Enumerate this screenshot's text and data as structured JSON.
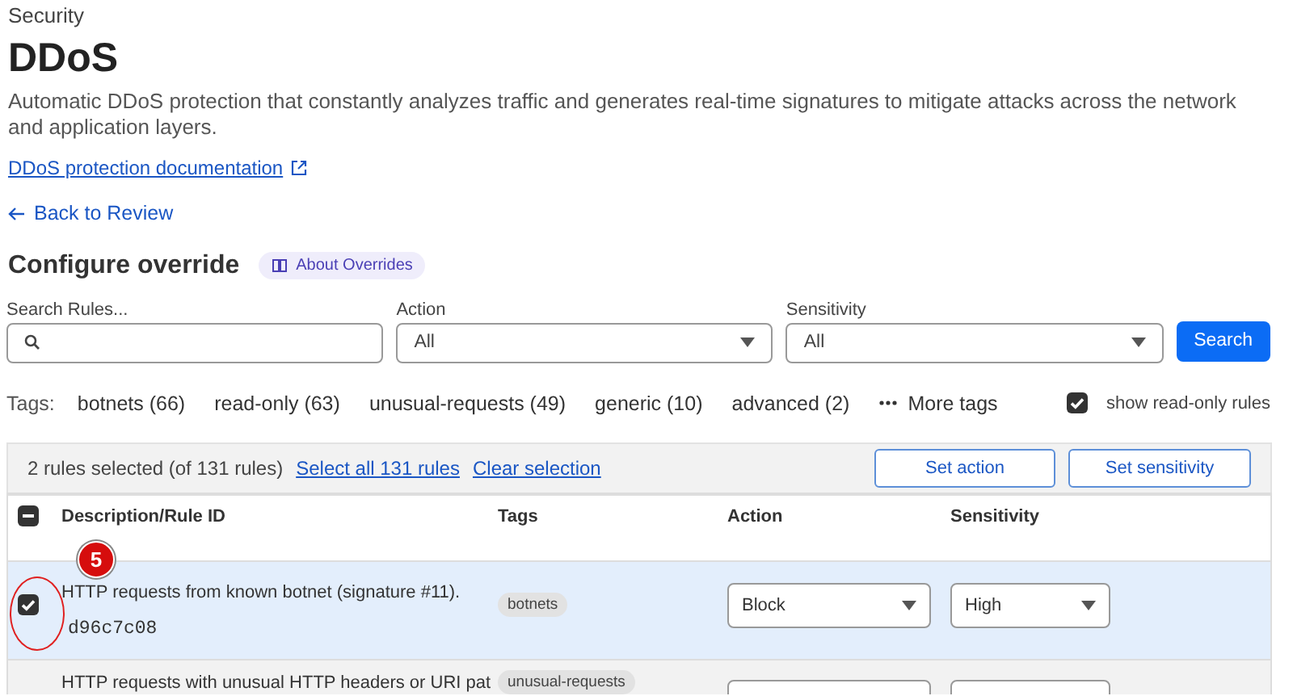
{
  "breadcrumb": "Security",
  "title": "DDoS",
  "description": "Automatic DDoS protection that constantly analyzes traffic and generates real-time signatures to mitigate attacks across the network and application layers.",
  "doc_link": "DDoS protection documentation",
  "back_link": "Back to Review",
  "section": {
    "title": "Configure override",
    "about_button": "About Overrides"
  },
  "filters": {
    "search": {
      "label": "Search Rules..."
    },
    "selects": [
      {
        "label": "Action",
        "value": "All"
      },
      {
        "label": "Sensitivity",
        "value": "All"
      }
    ],
    "search_button": "Search"
  },
  "tags": {
    "label": "Tags:",
    "items": [
      "botnets (66)",
      "read-only (63)",
      "unusual-requests (49)",
      "generic (10)",
      "advanced (2)"
    ],
    "more": "More tags"
  },
  "show_read_only": {
    "label": "show read-only rules",
    "checked": true
  },
  "selection_bar": {
    "summary": "2 rules selected (of 131 rules)",
    "select_all": "Select all 131 rules",
    "clear": "Clear selection",
    "buttons": [
      "Set action",
      "Set sensitivity"
    ]
  },
  "table": {
    "select_all_partial": true,
    "columns": [
      "Description/Rule ID",
      "Tags",
      "Action",
      "Sensitivity"
    ],
    "rows": [
      {
        "selected": true,
        "description": "HTTP requests from known botnet (signature #11).",
        "rule_id": "d96c7c08",
        "tag": "botnets",
        "action": "Block",
        "sensitivity": "High"
      },
      {
        "selected": false,
        "description": "HTTP requests with unusual HTTP headers or URI pat",
        "tag": "unusual-requests"
      }
    ]
  },
  "annotation": {
    "step": "5"
  }
}
